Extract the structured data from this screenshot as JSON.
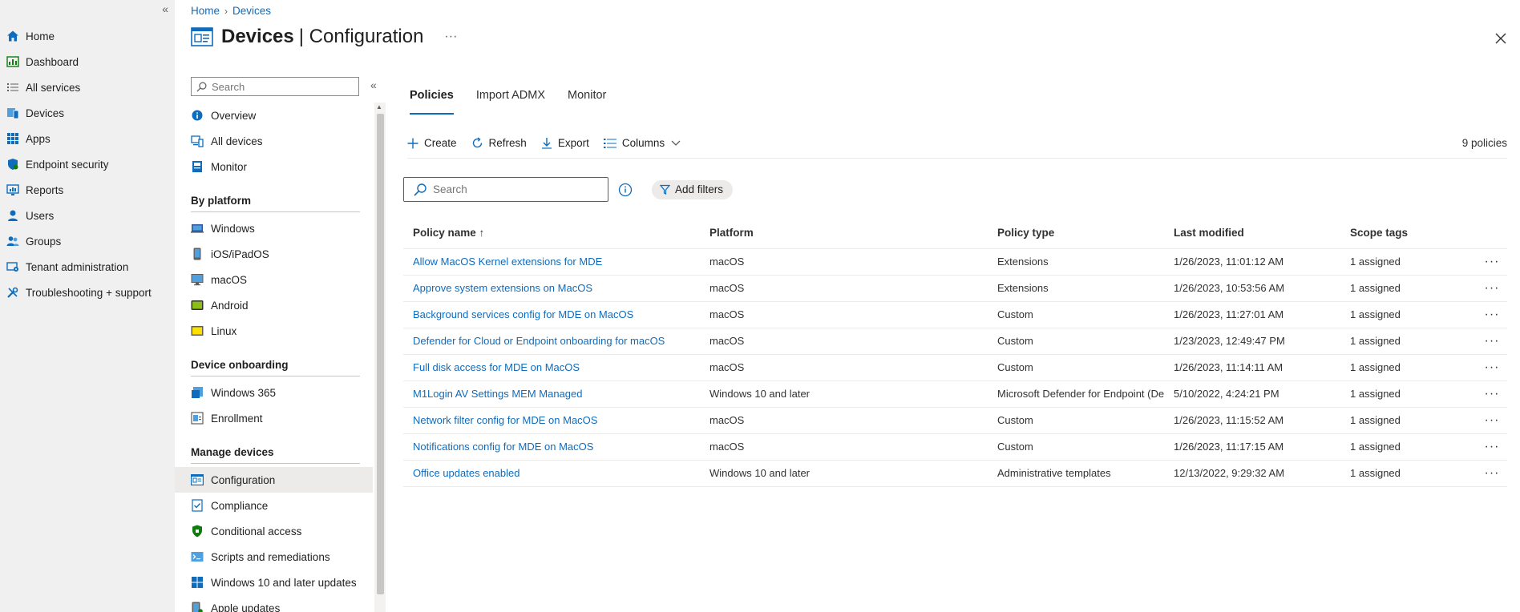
{
  "portal_nav": {
    "items": [
      {
        "label": "Home",
        "icon": "home-icon"
      },
      {
        "label": "Dashboard",
        "icon": "dashboard-icon"
      },
      {
        "label": "All services",
        "icon": "list-icon"
      },
      {
        "label": "Devices",
        "icon": "devices-icon"
      },
      {
        "label": "Apps",
        "icon": "apps-grid-icon"
      },
      {
        "label": "Endpoint security",
        "icon": "shield-icon"
      },
      {
        "label": "Reports",
        "icon": "reports-icon"
      },
      {
        "label": "Users",
        "icon": "user-icon"
      },
      {
        "label": "Groups",
        "icon": "groups-icon"
      },
      {
        "label": "Tenant administration",
        "icon": "tenant-icon"
      },
      {
        "label": "Troubleshooting + support",
        "icon": "wrench-icon"
      }
    ]
  },
  "breadcrumb": [
    "Home",
    "Devices"
  ],
  "header": {
    "title": "Devices",
    "subtitle": "Configuration",
    "more": "···"
  },
  "blade": {
    "search_placeholder": "Search",
    "top_items": [
      "Overview",
      "All devices",
      "Monitor"
    ],
    "sections": [
      {
        "title": "By platform",
        "items": [
          "Windows",
          "iOS/iPadOS",
          "macOS",
          "Android",
          "Linux"
        ]
      },
      {
        "title": "Device onboarding",
        "items": [
          "Windows 365",
          "Enrollment"
        ]
      },
      {
        "title": "Manage devices",
        "items": [
          "Configuration",
          "Compliance",
          "Conditional access",
          "Scripts and remediations",
          "Windows 10 and later updates",
          "Apple updates"
        ]
      }
    ],
    "active_item": "Configuration"
  },
  "tabs": [
    "Policies",
    "Import ADMX",
    "Monitor"
  ],
  "active_tab": "Policies",
  "toolbar": {
    "create": "Create",
    "refresh": "Refresh",
    "export": "Export",
    "columns": "Columns",
    "count": "9 policies"
  },
  "filter": {
    "search_placeholder": "Search",
    "add_filters": "Add filters"
  },
  "grid": {
    "columns": [
      "Policy name ↑",
      "Platform",
      "Policy type",
      "Last modified",
      "Scope tags"
    ],
    "rows": [
      [
        "Allow MacOS Kernel extensions for MDE",
        "macOS",
        "Extensions",
        "1/26/2023, 11:01:12 AM",
        "1 assigned"
      ],
      [
        "Approve system extensions on MacOS",
        "macOS",
        "Extensions",
        "1/26/2023, 10:53:56 AM",
        "1 assigned"
      ],
      [
        "Background services config for MDE on MacOS",
        "macOS",
        "Custom",
        "1/26/2023, 11:27:01 AM",
        "1 assigned"
      ],
      [
        "Defender for Cloud or Endpoint onboarding for macOS",
        "macOS",
        "Custom",
        "1/23/2023, 12:49:47 PM",
        "1 assigned"
      ],
      [
        "Full disk access for MDE on MacOS",
        "macOS",
        "Custom",
        "1/26/2023, 11:14:11 AM",
        "1 assigned"
      ],
      [
        "M1Login AV Settings MEM Managed",
        "Windows 10 and later",
        "Microsoft Defender for Endpoint (De",
        "5/10/2022, 4:24:21 PM",
        "1 assigned"
      ],
      [
        "Network filter config for MDE on MacOS",
        "macOS",
        "Custom",
        "1/26/2023, 11:15:52 AM",
        "1 assigned"
      ],
      [
        "Notifications config for MDE on MacOS",
        "macOS",
        "Custom",
        "1/26/2023, 11:17:15 AM",
        "1 assigned"
      ],
      [
        "Office updates enabled",
        "Windows 10 and later",
        "Administrative templates",
        "12/13/2022, 9:29:32 AM",
        "1 assigned"
      ]
    ],
    "row_more": "···"
  },
  "colors": {
    "accent": "#0f6cbd",
    "nav_bg": "#f0f0f0",
    "active_bg": "#edebe9"
  }
}
